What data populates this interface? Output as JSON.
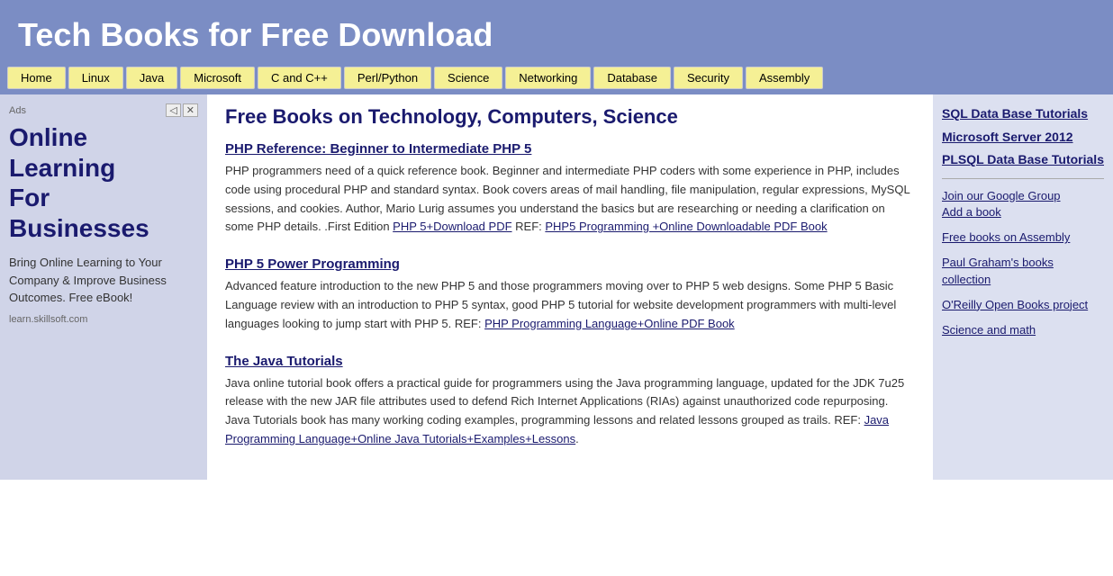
{
  "header": {
    "title": "Tech Books for Free Download"
  },
  "nav": {
    "items": [
      {
        "label": "Home",
        "href": "#"
      },
      {
        "label": "Linux",
        "href": "#"
      },
      {
        "label": "Java",
        "href": "#"
      },
      {
        "label": "Microsoft",
        "href": "#"
      },
      {
        "label": "C and C++",
        "href": "#"
      },
      {
        "label": "Perl/Python",
        "href": "#"
      },
      {
        "label": "Science",
        "href": "#"
      },
      {
        "label": "Networking",
        "href": "#"
      },
      {
        "label": "Database",
        "href": "#"
      },
      {
        "label": "Security",
        "href": "#"
      },
      {
        "label": "Assembly",
        "href": "#"
      }
    ]
  },
  "content": {
    "heading": "Free Books on Technology, Computers, Science",
    "books": [
      {
        "id": "book1",
        "title": "PHP Reference: Beginner to Intermediate PHP 5",
        "href": "#",
        "description": "PHP programmers need of a quick reference book. Beginner and intermediate PHP coders with some experience in PHP, includes code using procedural PHP and standard syntax. Book covers areas of mail handling, file manipulation, regular expressions, MySQL sessions, and cookies. Author, Mario Lurig assumes you understand the basics but are researching or needing a clarification on some PHP details. .First Edition",
        "links": [
          {
            "text": "PHP 5+Download PDF",
            "href": "#"
          },
          {
            "text": "PHP5 Programming +Online Downloadable PDF Book",
            "href": "#"
          }
        ],
        "ref_prefix": "REF: "
      },
      {
        "id": "book2",
        "title": "PHP 5 Power Programming",
        "href": "#",
        "description": "Advanced feature introduction to the new PHP 5 and those programmers moving over to PHP 5 web designs. Some PHP 5 Basic Language review with an introduction to PHP 5 syntax, good PHP 5 tutorial for website development programmers with multi-level languages looking to jump start with PHP 5. REF:",
        "links": [
          {
            "text": "PHP Programming Language+Online PDF Book",
            "href": "#"
          }
        ],
        "ref_prefix": "REF: "
      },
      {
        "id": "book3",
        "title": "The Java Tutorials",
        "href": "#",
        "description": "Java online tutorial book offers a practical guide for programmers using the Java programming language, updated for the JDK 7u25 release with the new JAR file attributes used to defend Rich Internet Applications (RIAs) against unauthorized code repurposing. Java Tutorials book has many working coding examples, programming lessons and related lessons grouped as trails. REF:",
        "links": [
          {
            "text": "Java Programming Language+Online Java Tutorials+Examples+Lessons",
            "href": "#"
          }
        ],
        "ref_prefix": "REF: "
      }
    ]
  },
  "left_sidebar": {
    "ad_label": "Ads",
    "headline_line1": "Online",
    "headline_line2": "Learning",
    "headline_line3": "For",
    "headline_line4": "Businesses",
    "body": "Bring Online Learning to Your Company & Improve Business Outcomes. Free eBook!",
    "footer": "learn.skillsoft.com"
  },
  "right_sidebar": {
    "featured_links": [
      {
        "text": "SQL Data Base Tutorials",
        "href": "#",
        "bold": true
      },
      {
        "text": "Microsoft Server 2012",
        "href": "#",
        "bold": true
      },
      {
        "text": "PLSQL Data Base Tutorials",
        "href": "#",
        "bold": true
      }
    ],
    "extra_links": [
      {
        "text": "Join our Google Group",
        "href": "#"
      },
      {
        "text": "Add a book",
        "href": "#"
      },
      {
        "text": "Free books on Assembly",
        "href": "#"
      },
      {
        "text": "Paul Graham's books collection",
        "href": "#"
      },
      {
        "text": "O'Reilly Open Books project",
        "href": "#"
      },
      {
        "text": "Science and math",
        "href": "#"
      }
    ]
  }
}
